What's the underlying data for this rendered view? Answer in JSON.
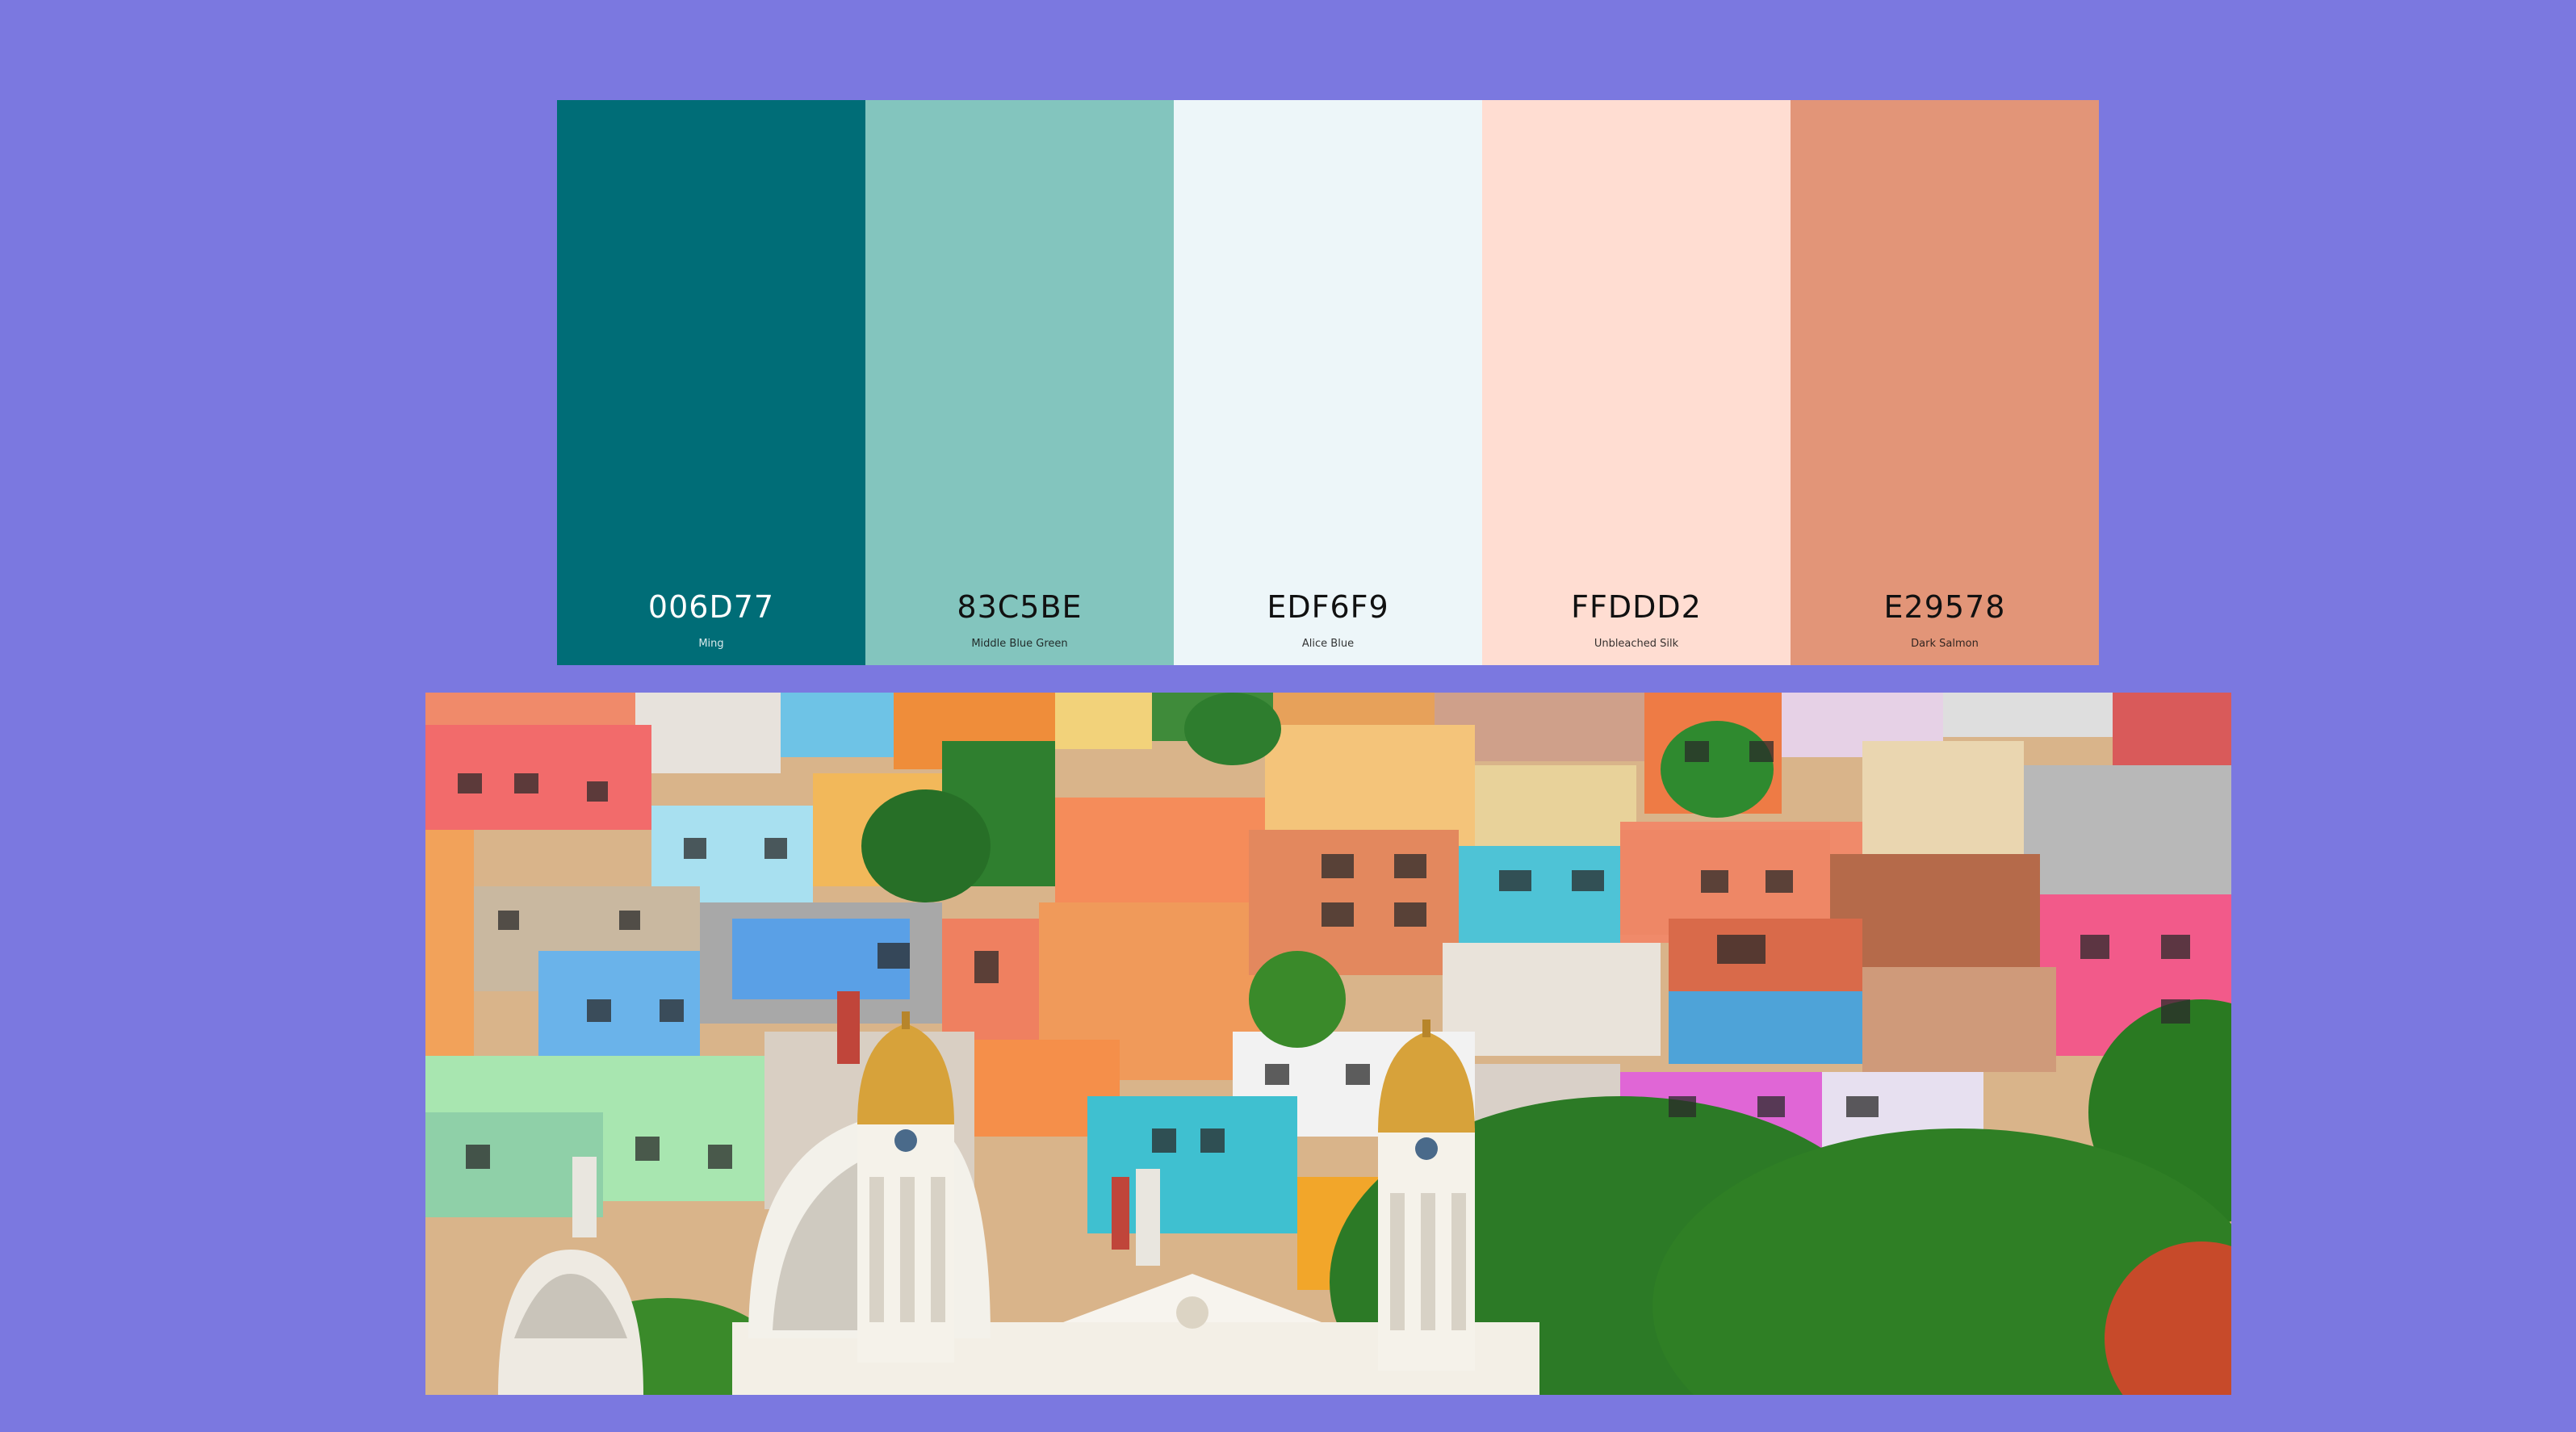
{
  "palette": {
    "swatches": [
      {
        "hex": "006D77",
        "name": "Ming",
        "color": "#006D77",
        "text_color": "#ffffff"
      },
      {
        "hex": "83C5BE",
        "name": "Middle Blue Green",
        "color": "#83C5BE",
        "text_color": "#111111"
      },
      {
        "hex": "EDF6F9",
        "name": "Alice Blue",
        "color": "#EDF6F9",
        "text_color": "#111111"
      },
      {
        "hex": "FFDDD2",
        "name": "Unbleached Silk",
        "color": "#FFDDD2",
        "text_color": "#111111"
      },
      {
        "hex": "E29578",
        "name": "Dark Salmon",
        "color": "#E29578",
        "text_color": "#111111"
      }
    ]
  },
  "colors": {
    "background": "#7b78e0"
  }
}
